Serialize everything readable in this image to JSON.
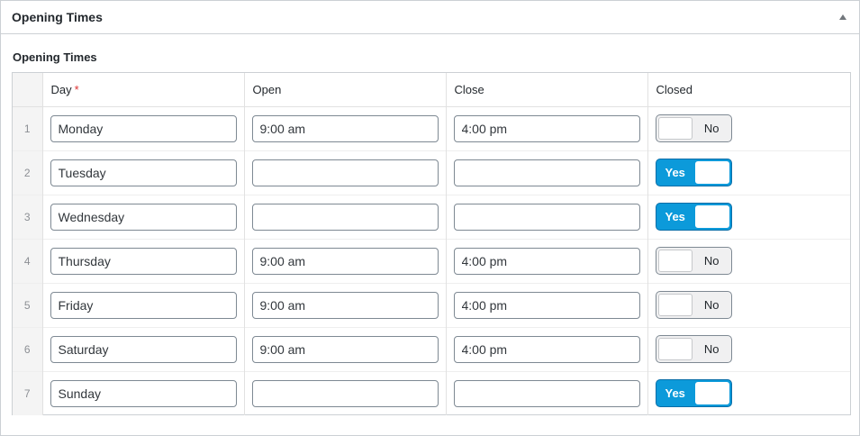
{
  "postbox": {
    "title": "Opening Times"
  },
  "field": {
    "label": "Opening Times"
  },
  "columns": {
    "day": "Day",
    "required_mark": "*",
    "open": "Open",
    "close": "Close",
    "closed": "Closed"
  },
  "toggle_labels": {
    "on": "Yes",
    "off": "No"
  },
  "colors": {
    "accent": "#0c9ada",
    "required": "#dc3232"
  },
  "icons": {
    "collapse": "triangle-up-icon"
  },
  "rows": [
    {
      "index": "1",
      "day": "Monday",
      "open": "9:00 am",
      "close": "4:00 pm",
      "closed": false
    },
    {
      "index": "2",
      "day": "Tuesday",
      "open": "",
      "close": "",
      "closed": true
    },
    {
      "index": "3",
      "day": "Wednesday",
      "open": "",
      "close": "",
      "closed": true
    },
    {
      "index": "4",
      "day": "Thursday",
      "open": "9:00 am",
      "close": "4:00 pm",
      "closed": false
    },
    {
      "index": "5",
      "day": "Friday",
      "open": "9:00 am",
      "close": "4:00 pm",
      "closed": false
    },
    {
      "index": "6",
      "day": "Saturday",
      "open": "9:00 am",
      "close": "4:00 pm",
      "closed": false
    },
    {
      "index": "7",
      "day": "Sunday",
      "open": "",
      "close": "",
      "closed": true
    }
  ]
}
